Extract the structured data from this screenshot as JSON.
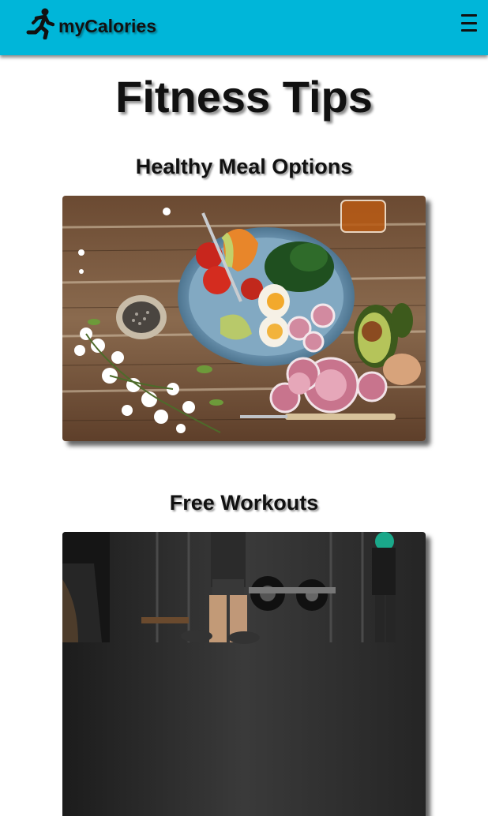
{
  "app": {
    "name": "myCalories",
    "logo_icon": "runner-icon",
    "brand_color": "#00b6d9"
  },
  "nav": {
    "menu_icon": "hamburger-menu-icon"
  },
  "page": {
    "title": "Fitness Tips"
  },
  "sections": [
    {
      "title": "Healthy Meal Options",
      "image": "healthy-meal-photo"
    },
    {
      "title": "Free Workouts",
      "image": "gym-workout-photo"
    }
  ]
}
